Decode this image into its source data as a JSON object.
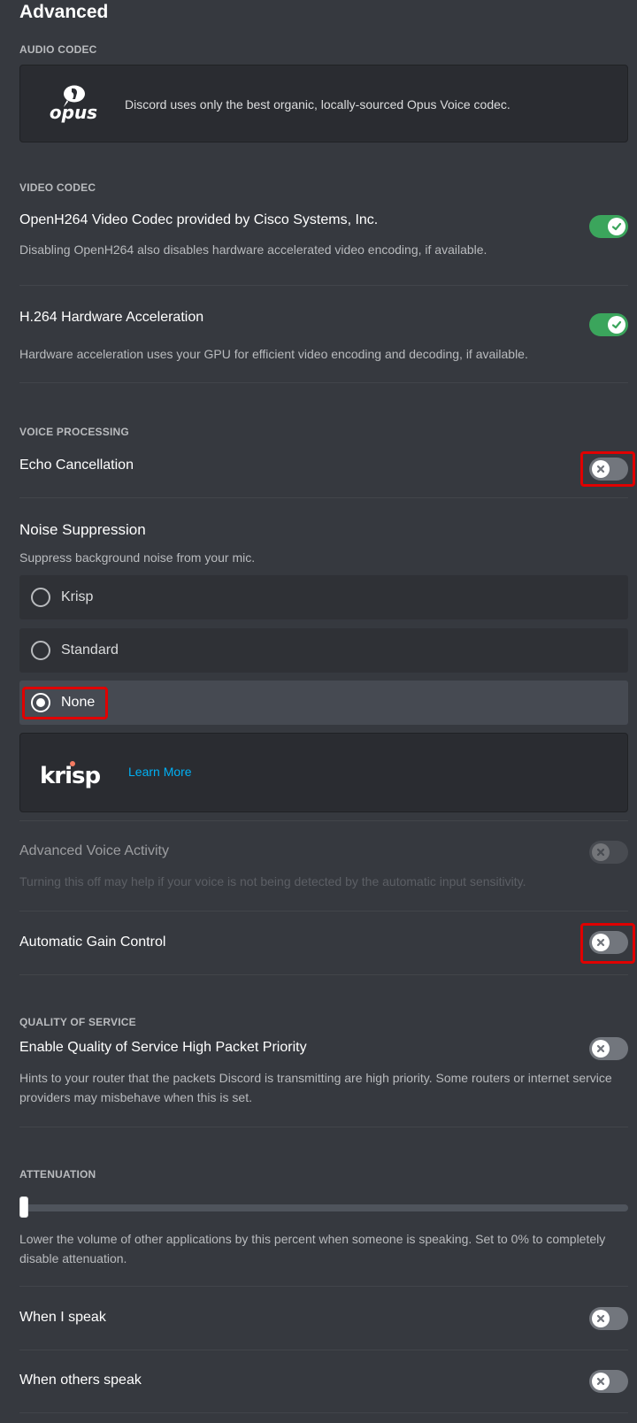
{
  "page": {
    "title": "Advanced"
  },
  "audio_codec": {
    "section_label": "Audio Codec",
    "logo": "opus-logo",
    "logo_text": "opus",
    "description": "Discord uses only the best organic, locally-sourced Opus Voice codec."
  },
  "video_codec": {
    "section_label": "Video Codec",
    "settings": [
      {
        "title": "OpenH264 Video Codec provided by Cisco Systems, Inc.",
        "description": "Disabling OpenH264 also disables hardware accelerated video encoding, if available.",
        "enabled": true
      },
      {
        "title": "H.264 Hardware Acceleration",
        "description": "Hardware acceleration uses your GPU for efficient video encoding and decoding, if available.",
        "enabled": true
      }
    ]
  },
  "voice_processing": {
    "section_label": "Voice Processing",
    "echo_cancellation": {
      "title": "Echo Cancellation",
      "enabled": false,
      "highlighted": true
    },
    "noise_suppression": {
      "title": "Noise Suppression",
      "description": "Suppress background noise from your mic.",
      "options": [
        {
          "label": "Krisp",
          "selected": false
        },
        {
          "label": "Standard",
          "selected": false
        },
        {
          "label": "None",
          "selected": true,
          "highlighted": true
        }
      ]
    },
    "krisp_banner": {
      "logo_text": "krisp",
      "link_label": "Learn More",
      "link_color": "#00b0f4",
      "dot_color": "#f57b62"
    },
    "advanced_voice_activity": {
      "title": "Advanced Voice Activity",
      "description": "Turning this off may help if your voice is not being detected by the automatic input sensitivity.",
      "enabled": false,
      "disabled": true
    },
    "automatic_gain_control": {
      "title": "Automatic Gain Control",
      "enabled": false,
      "highlighted": true
    }
  },
  "quality_of_service": {
    "section_label": "Quality of Service",
    "title": "Enable Quality of Service High Packet Priority",
    "description": "Hints to your router that the packets Discord is transmitting are high priority. Some routers or internet service providers may misbehave when this is set.",
    "enabled": false
  },
  "attenuation": {
    "section_label": "Attenuation",
    "value_percent": 0,
    "description": "Lower the volume of other applications by this percent when someone is speaking. Set to 0% to completely disable attenuation.",
    "when_i_speak": {
      "title": "When I speak",
      "enabled": false
    },
    "when_others_speak": {
      "title": "When others speak",
      "enabled": false
    }
  },
  "colors": {
    "background": "#36393f",
    "toggle_on": "#3ba55c",
    "toggle_off": "#72767d",
    "highlight": "#e00000"
  }
}
